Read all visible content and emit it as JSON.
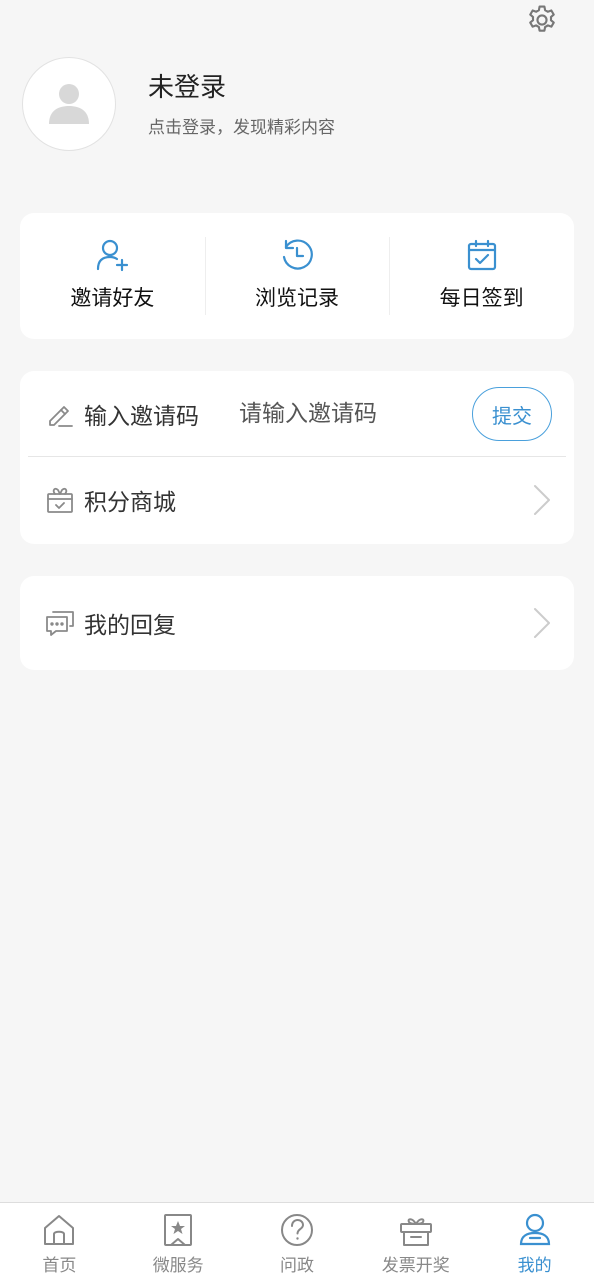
{
  "header": {
    "settings_icon": "gear-icon"
  },
  "profile": {
    "name": "未登录",
    "subtitle": "点击登录，发现精彩内容",
    "avatar_icon": "user-placeholder-icon"
  },
  "quick_actions": [
    {
      "label": "邀请好友",
      "icon": "add-user-icon"
    },
    {
      "label": "浏览记录",
      "icon": "history-icon"
    },
    {
      "label": "每日签到",
      "icon": "calendar-check-icon"
    }
  ],
  "invite": {
    "label": "输入邀请码",
    "placeholder": "请输入邀请码",
    "submit_label": "提交",
    "icon": "pencil-icon"
  },
  "points_mall": {
    "label": "积分商城",
    "icon": "gift-box-icon"
  },
  "my_replies": {
    "label": "我的回复",
    "icon": "chat-bubbles-icon"
  },
  "tabbar": {
    "items": [
      {
        "label": "首页",
        "icon": "home-icon"
      },
      {
        "label": "微服务",
        "icon": "bookmark-star-icon"
      },
      {
        "label": "问政",
        "icon": "question-icon"
      },
      {
        "label": "发票开奖",
        "icon": "gift-icon"
      },
      {
        "label": "我的",
        "icon": "person-icon"
      }
    ],
    "active_index": 4
  },
  "colors": {
    "accent": "#3a90d0",
    "background": "#f6f6f6",
    "card": "#ffffff",
    "tab_inactive": "#888888"
  }
}
